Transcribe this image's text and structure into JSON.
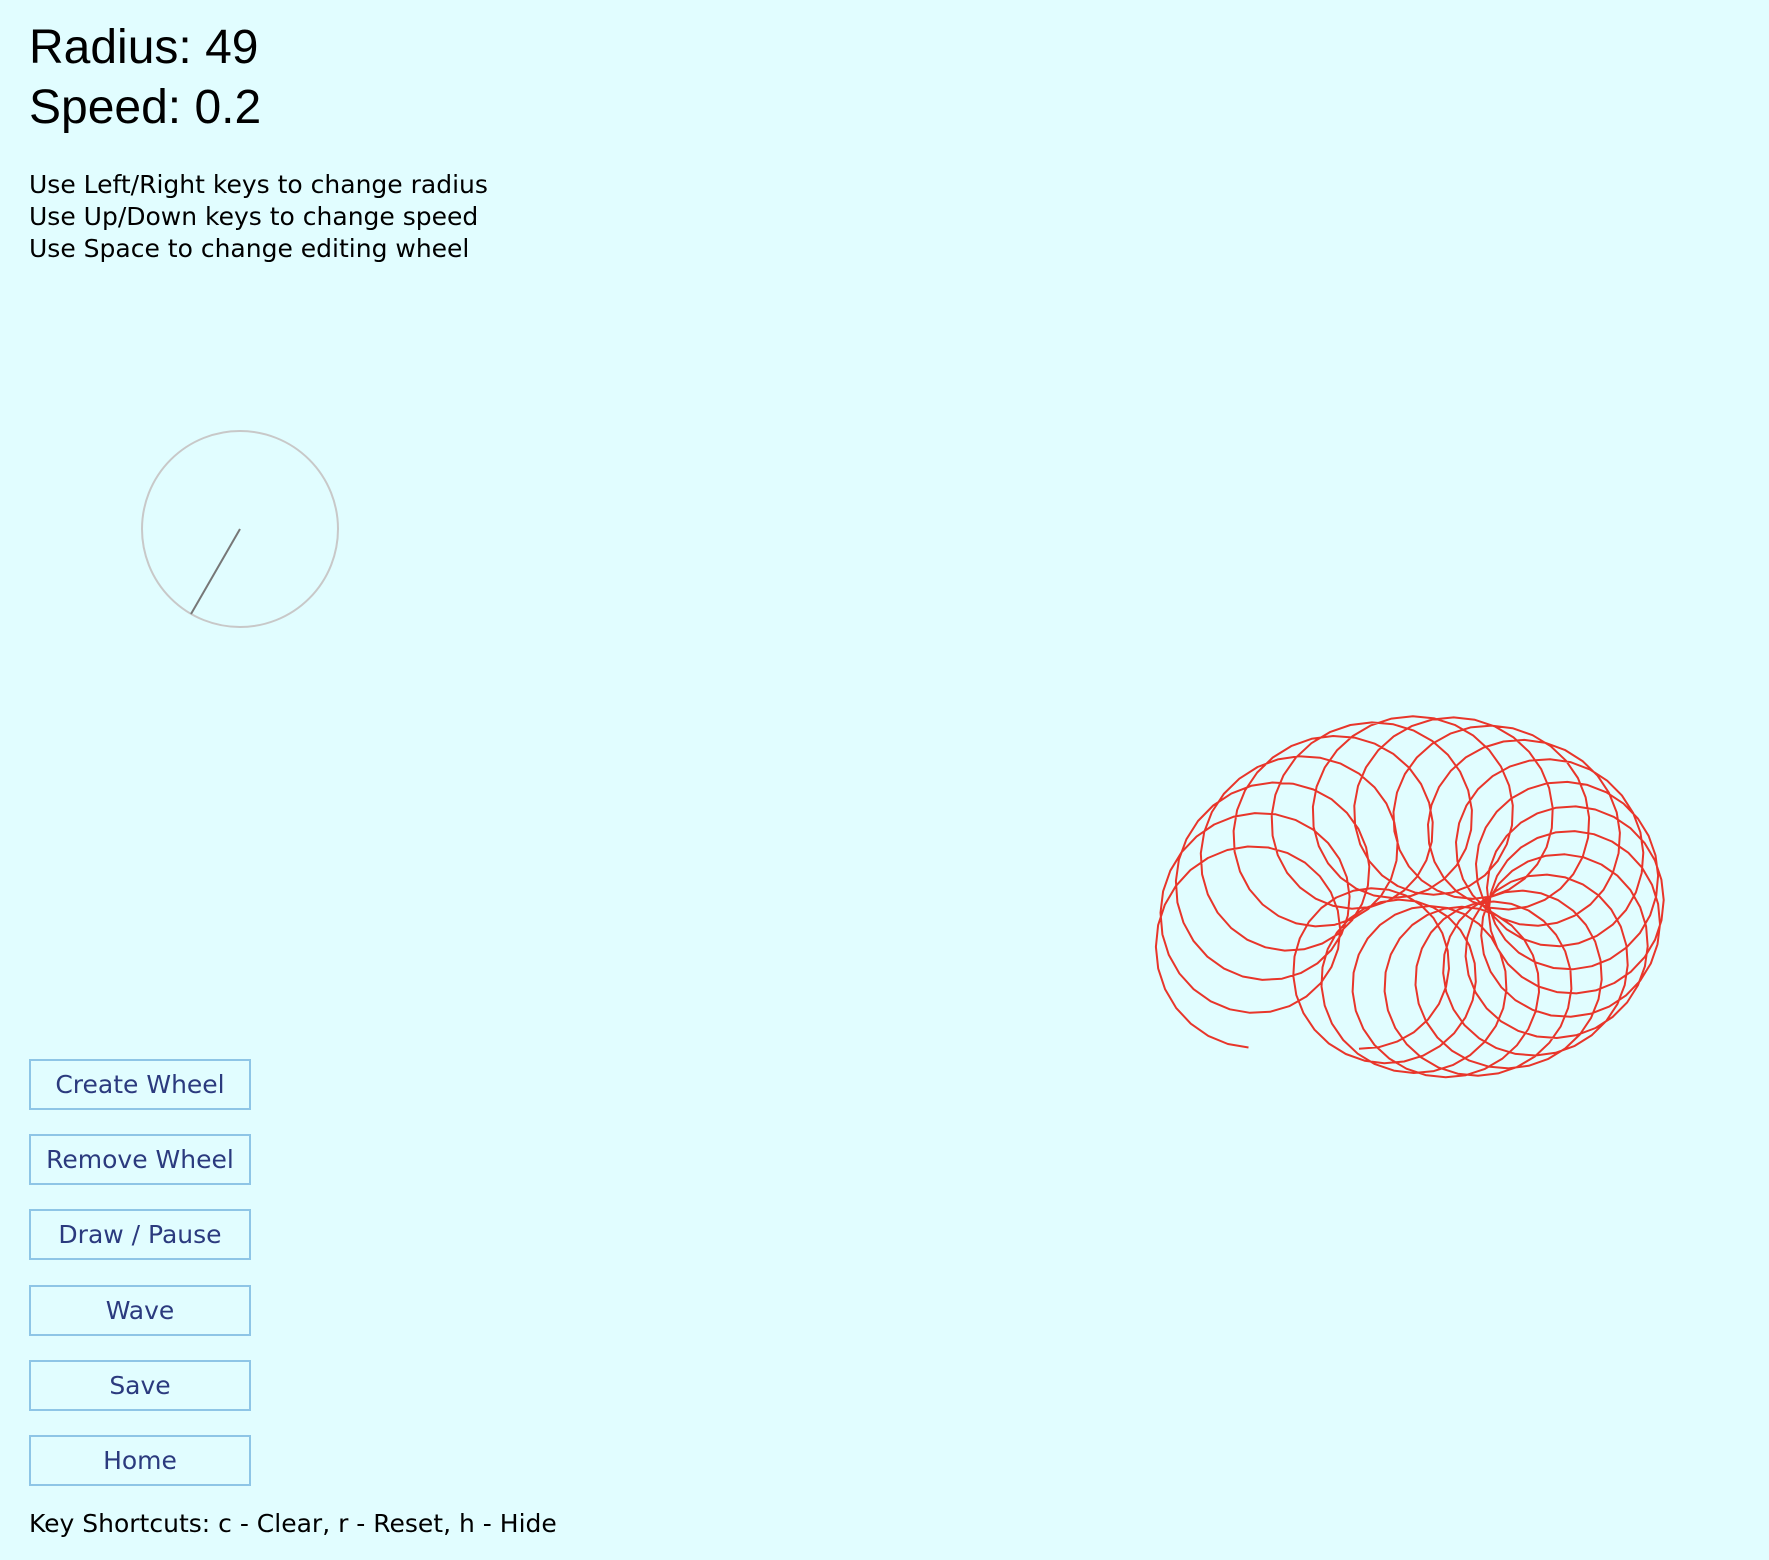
{
  "readouts": {
    "radius": "Radius: 49",
    "speed": "Speed: 0.2"
  },
  "instructions": [
    "Use Left/Right keys to change radius",
    "Use Up/Down keys to change speed",
    "Use Space to change editing wheel"
  ],
  "buttons": {
    "create_wheel": "Create Wheel",
    "remove_wheel": "Remove Wheel",
    "draw_pause": "Draw / Pause",
    "wave": "Wave",
    "save": "Save",
    "home": "Home"
  },
  "shortcuts": "Key Shortcuts: c - Clear, r - Reset, h - Hide",
  "colors": {
    "background": "#e1fdff",
    "trace": "#e8352a",
    "wheel_outline": "#c8c8c8",
    "wheel_arm": "#777777",
    "button_border": "#8ec5e6",
    "button_text": "#2b3a7e"
  }
}
